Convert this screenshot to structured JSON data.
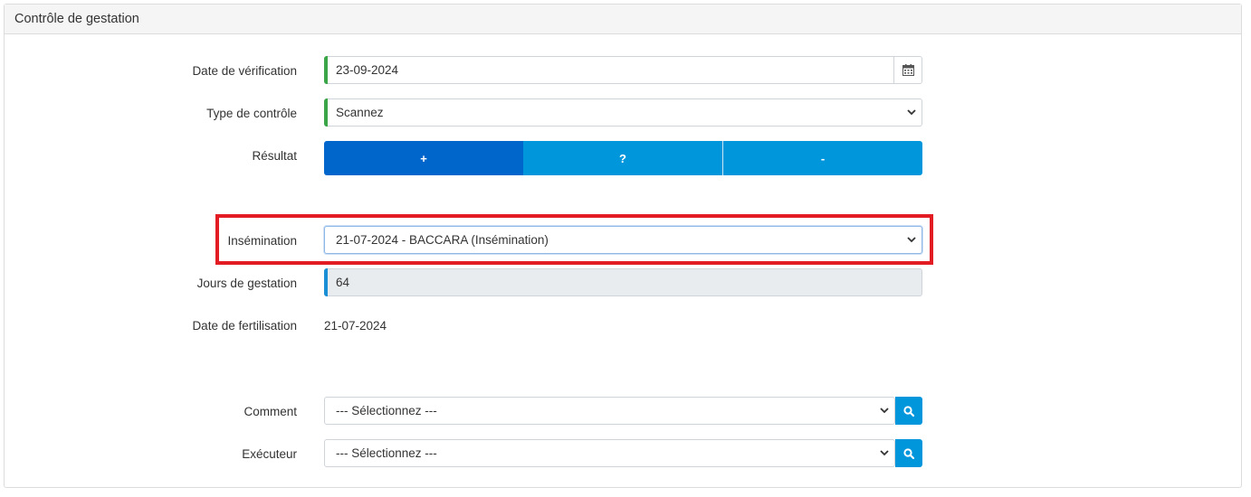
{
  "panel": {
    "title": "Contrôle de gestation"
  },
  "fields": {
    "verification_date": {
      "label": "Date de vérification",
      "value": "23-09-2024"
    },
    "control_type": {
      "label": "Type de contrôle",
      "value": "Scannez"
    },
    "result": {
      "label": "Résultat",
      "options": [
        "+",
        "?",
        "-"
      ],
      "selected": "+"
    },
    "insemination": {
      "label": "Insémination",
      "value": "21-07-2024 - BACCARA (Insémination)"
    },
    "gestation_days": {
      "label": "Jours de gestation",
      "value": "64"
    },
    "fertilisation_date": {
      "label": "Date de fertilisation",
      "value": "21-07-2024"
    },
    "comment": {
      "label": "Comment",
      "value": "--- Sélectionnez ---"
    },
    "executor": {
      "label": "Exécuteur",
      "value": "--- Sélectionnez ---"
    }
  },
  "icons": {
    "calendar": "calendar-icon",
    "search": "search-icon",
    "chevron": "chevron-down-icon"
  },
  "colors": {
    "active_button": "#0066cc",
    "button": "#0096dc",
    "valid_marker": "#3aa648",
    "info_marker": "#1a8fd6",
    "highlight": "#e31b23"
  }
}
